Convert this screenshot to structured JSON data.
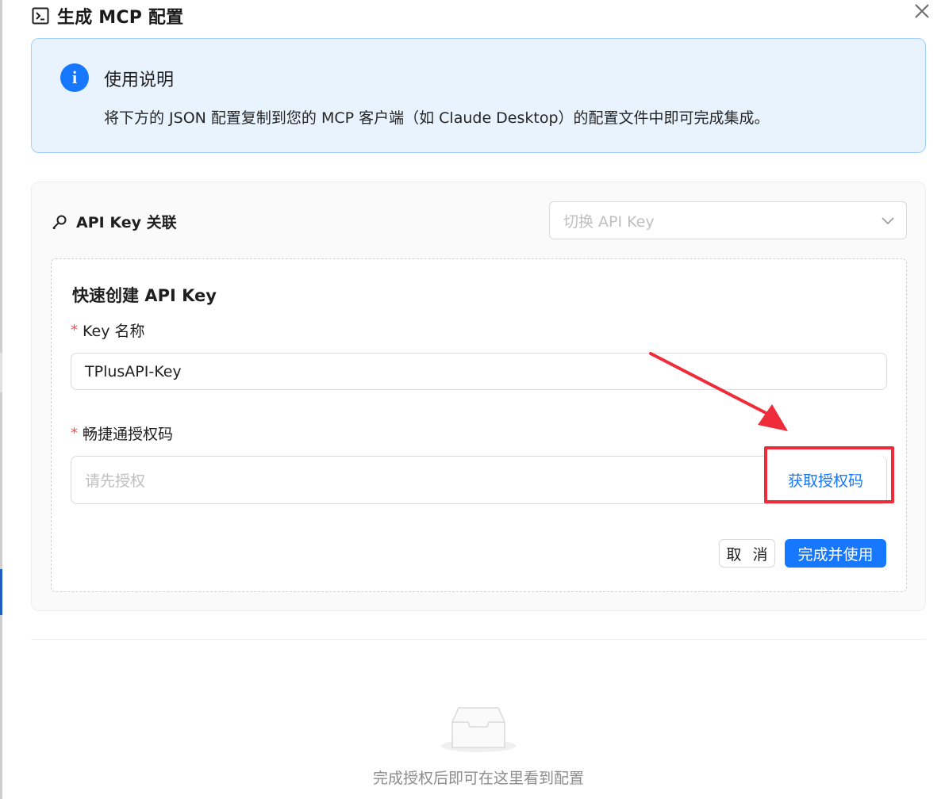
{
  "dialog": {
    "title": "生成 MCP 配置",
    "close_icon": "close-icon"
  },
  "alert": {
    "icon": "info-icon",
    "title": "使用说明",
    "description": "将下方的 JSON 配置复制到您的 MCP 客户端（如 Claude Desktop）的配置文件中即可完成集成。"
  },
  "api_key_section": {
    "icon": "key-search-icon",
    "title": "API Key 关联",
    "select": {
      "placeholder": "切换 API Key",
      "icon": "chevron-down-icon"
    }
  },
  "quick_create": {
    "title": "快速创建 API Key",
    "required_marker": "*",
    "key_name": {
      "label": "Key 名称",
      "value": "TPlusAPI-Key"
    },
    "auth_code": {
      "label": "畅捷通授权码",
      "placeholder": "请先授权",
      "addon_link": "获取授权码"
    },
    "cancel_label": "取 消",
    "submit_label": "完成并使用"
  },
  "annotation": {
    "color": "#ee2c3a"
  },
  "empty_state": {
    "icon": "empty-inbox-icon",
    "text": "完成授权后即可在这里看到配置"
  },
  "colors": {
    "primary": "#1677ff",
    "alert_bg": "#e8f3fe",
    "alert_border": "#9fd0fb",
    "required": "#ff4d4f"
  }
}
